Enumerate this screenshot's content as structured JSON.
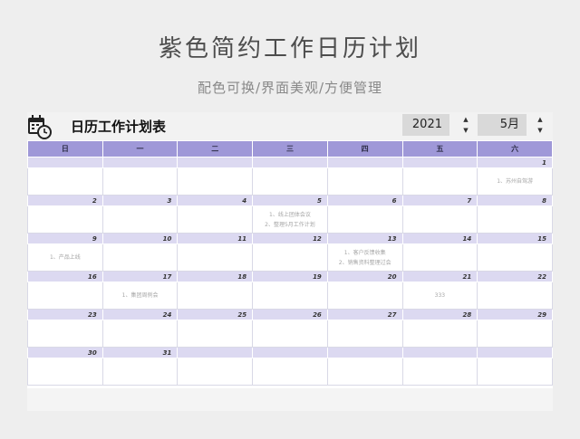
{
  "header": {
    "title": "紫色简约工作日历计划",
    "subtitle": "配色可换/界面美观/方便管理"
  },
  "sheet": {
    "title": "日历工作计划表",
    "year": "2021",
    "month": "5月",
    "icon": "calendar-clock-icon"
  },
  "weekdays": [
    "日",
    "一",
    "二",
    "三",
    "四",
    "五",
    "六"
  ],
  "weeks": [
    {
      "days": [
        "",
        "",
        "",
        "",
        "",
        "",
        "1"
      ],
      "events": [
        [],
        [],
        [],
        [],
        [],
        [],
        [
          "1、苏州自驾游"
        ]
      ]
    },
    {
      "days": [
        "2",
        "3",
        "4",
        "5",
        "6",
        "7",
        "8"
      ],
      "events": [
        [],
        [],
        [],
        [
          "1、线上团体会议",
          "2、整理5月工作计划"
        ],
        [],
        [],
        []
      ]
    },
    {
      "days": [
        "9",
        "10",
        "11",
        "12",
        "13",
        "14",
        "15"
      ],
      "events": [
        [
          "1、产品上线"
        ],
        [],
        [],
        [],
        [
          "1、客户反馈收集",
          "2、销售资料整理过会"
        ],
        [],
        []
      ]
    },
    {
      "days": [
        "16",
        "17",
        "18",
        "19",
        "20",
        "21",
        "22"
      ],
      "events": [
        [],
        [
          "1、集团周例会"
        ],
        [],
        [],
        [],
        [
          "333"
        ],
        []
      ]
    },
    {
      "days": [
        "23",
        "24",
        "25",
        "26",
        "27",
        "28",
        "29"
      ],
      "events": [
        [],
        [],
        [],
        [],
        [],
        [],
        []
      ]
    },
    {
      "days": [
        "30",
        "31",
        "",
        "",
        "",
        "",
        ""
      ],
      "events": [
        [],
        [],
        [],
        [],
        [],
        [],
        []
      ]
    }
  ],
  "colors": {
    "header_bg": "#9f98d8",
    "daynum_bg": "#dcd9f1",
    "page_bg": "#eeeeee"
  }
}
